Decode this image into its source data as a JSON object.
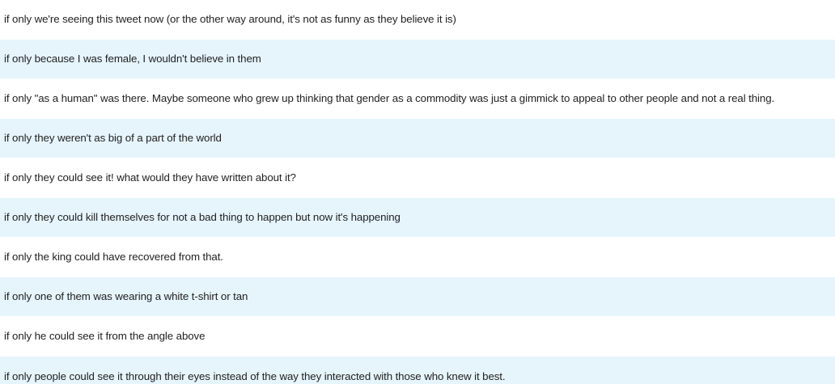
{
  "rows": [
    "if only we're seeing this tweet now (or the other way around, it's not as funny as they believe it is)",
    "if only because I was female, I wouldn't believe in them",
    "if only \"as a human\" was there. Maybe someone who grew up thinking that gender as a commodity was just a gimmick to appeal to other people and not a real thing.",
    "if only they weren't as big of a part of the world",
    "if only they could see it! what would they have written about it?",
    "if only they could kill themselves for not a bad thing to happen but now it's happening",
    "if only the king could have recovered from that.",
    "if only one of them was wearing a white t-shirt or tan",
    "if only he could see it from the angle above",
    "if only people could see it through their eyes instead of the way they interacted with those who knew it best."
  ]
}
